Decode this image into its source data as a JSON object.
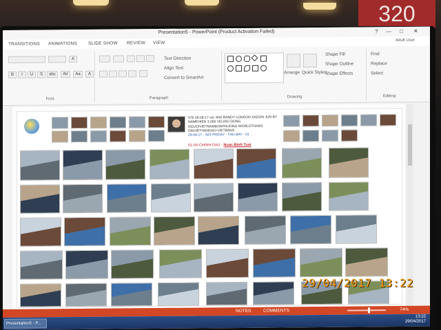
{
  "room_sign": "320",
  "window": {
    "title": "Presentation5 - PowerPoint (Product Activation Failed)",
    "controls": [
      "?",
      "—",
      "□",
      "✕"
    ]
  },
  "ribbon_tabs": [
    "TRANSITIONS",
    "ANIMATIONS",
    "SLIDE SHOW",
    "REVIEW",
    "VIEW"
  ],
  "user": "Adult User",
  "ribbon": {
    "groups": {
      "font": "Font",
      "paragraph": "Paragraph",
      "drawing": "Drawing",
      "editing": "Editing"
    },
    "paragraph_commands": [
      "Text Direction",
      "Align Text",
      "Convert to SmartArt"
    ],
    "drawing_commands": [
      "Arrange",
      "Quick Styles"
    ],
    "shape_commands": [
      "Shape Fill",
      "Shape Outline",
      "Shape Effects"
    ],
    "editing_commands": [
      "Find",
      "Replace",
      "Select"
    ],
    "font_buttons": [
      "B",
      "I",
      "U",
      "S",
      "abc",
      "AV",
      "Aa",
      "A"
    ]
  },
  "slide": {
    "header_lines": [
      "576 28-08-17 vol. MAI RANDY LONDON XADON JUN BY",
      "NAMEHIEN 3,000 YELIRO DONG",
      "NGUOIVIETNAMBONPHUONG-WORLDTHANS",
      "DAIVIETHANDAO-VIETBANS",
      "29-04-17 - SAT-FRIDAY - THU BAY - 01"
    ],
    "header_red": "01-04-CHINH DAU -",
    "header_link": "Nuoc Binh Tuoi"
  },
  "statusbar": {
    "notes": "NOTES",
    "comments": "COMMENTS",
    "zoom": "74%"
  },
  "taskbar": {
    "app_button": "Presentation5 - P...",
    "time": "13:22",
    "date": "29/04/2017"
  },
  "camera_timestamp": "29/04/2017  13:22",
  "colors": {
    "status_orange": "#d24726",
    "taskbar_blue": "#1c3563",
    "stamp_orange": "#f7a21b",
    "sign_red": "#a12b2b"
  }
}
